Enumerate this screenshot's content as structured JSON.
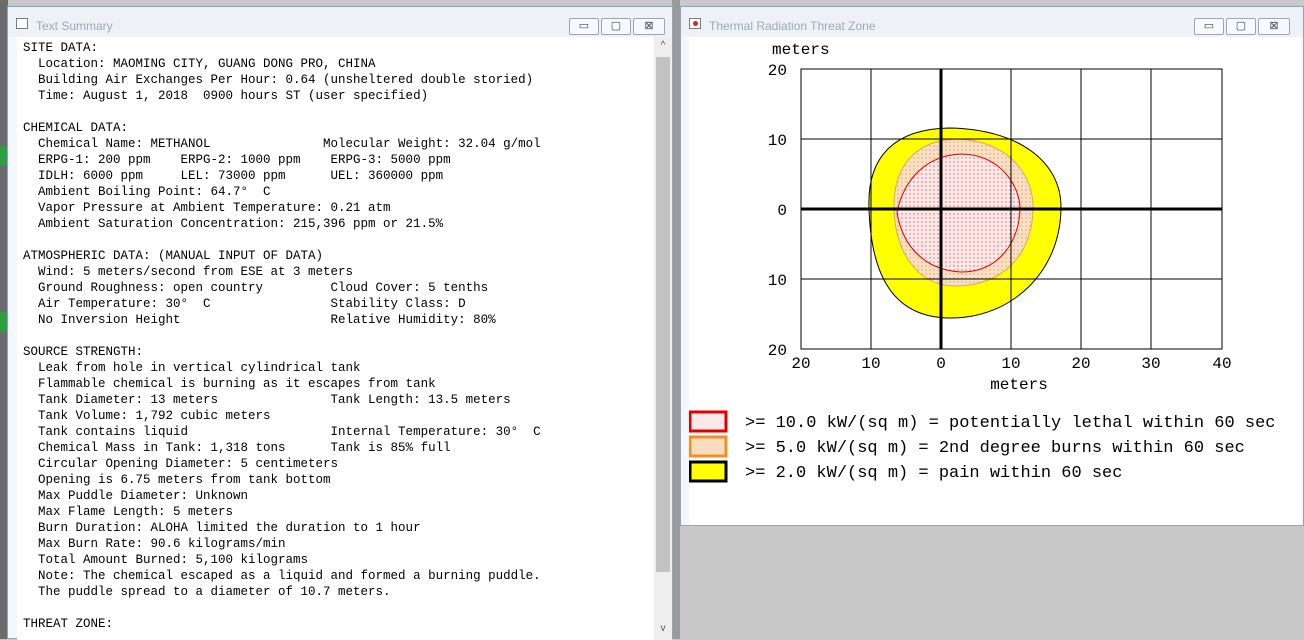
{
  "left_window": {
    "title": "Text Summary",
    "controls": {
      "minimize": "▭",
      "maximize": "▢",
      "close": "⊠"
    },
    "lines": [
      "SITE DATA:",
      "  Location: MAOMING CITY, GUANG DONG PRO, CHINA",
      "  Building Air Exchanges Per Hour: 0.64 (unsheltered double storied)",
      "  Time: August 1, 2018  0900 hours ST (user specified)",
      "",
      "CHEMICAL DATA:",
      "  Chemical Name: METHANOL               Molecular Weight: 32.04 g/mol",
      "  ERPG-1: 200 ppm    ERPG-2: 1000 ppm    ERPG-3: 5000 ppm",
      "  IDLH: 6000 ppm     LEL: 73000 ppm      UEL: 360000 ppm",
      "  Ambient Boiling Point: 64.7°  C",
      "  Vapor Pressure at Ambient Temperature: 0.21 atm",
      "  Ambient Saturation Concentration: 215,396 ppm or 21.5%",
      "",
      "ATMOSPHERIC DATA: (MANUAL INPUT OF DATA)",
      "  Wind: 5 meters/second from ESE at 3 meters",
      "  Ground Roughness: open country         Cloud Cover: 5 tenths",
      "  Air Temperature: 30°  C                Stability Class: D",
      "  No Inversion Height                    Relative Humidity: 80%",
      "",
      "SOURCE STRENGTH:",
      "  Leak from hole in vertical cylindrical tank",
      "  Flammable chemical is burning as it escapes from tank",
      "  Tank Diameter: 13 meters               Tank Length: 13.5 meters",
      "  Tank Volume: 1,792 cubic meters",
      "  Tank contains liquid                   Internal Temperature: 30°  C",
      "  Chemical Mass in Tank: 1,318 tons      Tank is 85% full",
      "  Circular Opening Diameter: 5 centimeters",
      "  Opening is 6.75 meters from tank bottom",
      "  Max Puddle Diameter: Unknown",
      "  Max Flame Length: 5 meters",
      "  Burn Duration: ALOHA limited the duration to 1 hour",
      "  Max Burn Rate: 90.6 kilograms/min",
      "  Total Amount Burned: 5,100 kilograms",
      "  Note: The chemical escaped as a liquid and formed a burning puddle.",
      "  The puddle spread to a diameter of 10.7 meters.",
      "",
      "THREAT ZONE:"
    ],
    "scroll": {
      "up": "^",
      "down": "v"
    }
  },
  "right_window": {
    "title": "Thermal Radiation Threat Zone",
    "controls": {
      "minimize": "▭",
      "maximize": "▢",
      "close": "⊠"
    },
    "plot": {
      "y_unit": "meters",
      "x_unit": "meters",
      "y_ticks": [
        "20",
        "10",
        "0",
        "10",
        "20"
      ],
      "x_ticks": [
        "20",
        "10",
        "0",
        "10",
        "20",
        "30",
        "40"
      ]
    },
    "legend": [
      {
        "text": ">= 10.0 kW/(sq m) = potentially lethal within 60 sec",
        "border": "#e00000",
        "fill": "#fbe8e8"
      },
      {
        "text": ">= 5.0 kW/(sq m) = 2nd degree burns within 60 sec",
        "border": "#f09020",
        "fill": "#f7dcc0"
      },
      {
        "text": ">= 2.0 kW/(sq m) = pain within 60 sec",
        "border": "#000000",
        "fill": "#ffff00"
      }
    ],
    "zone_colors": {
      "yellow": "#ffff00",
      "orange": "#f8e0c4",
      "red_dots": "#cc3333"
    }
  }
}
